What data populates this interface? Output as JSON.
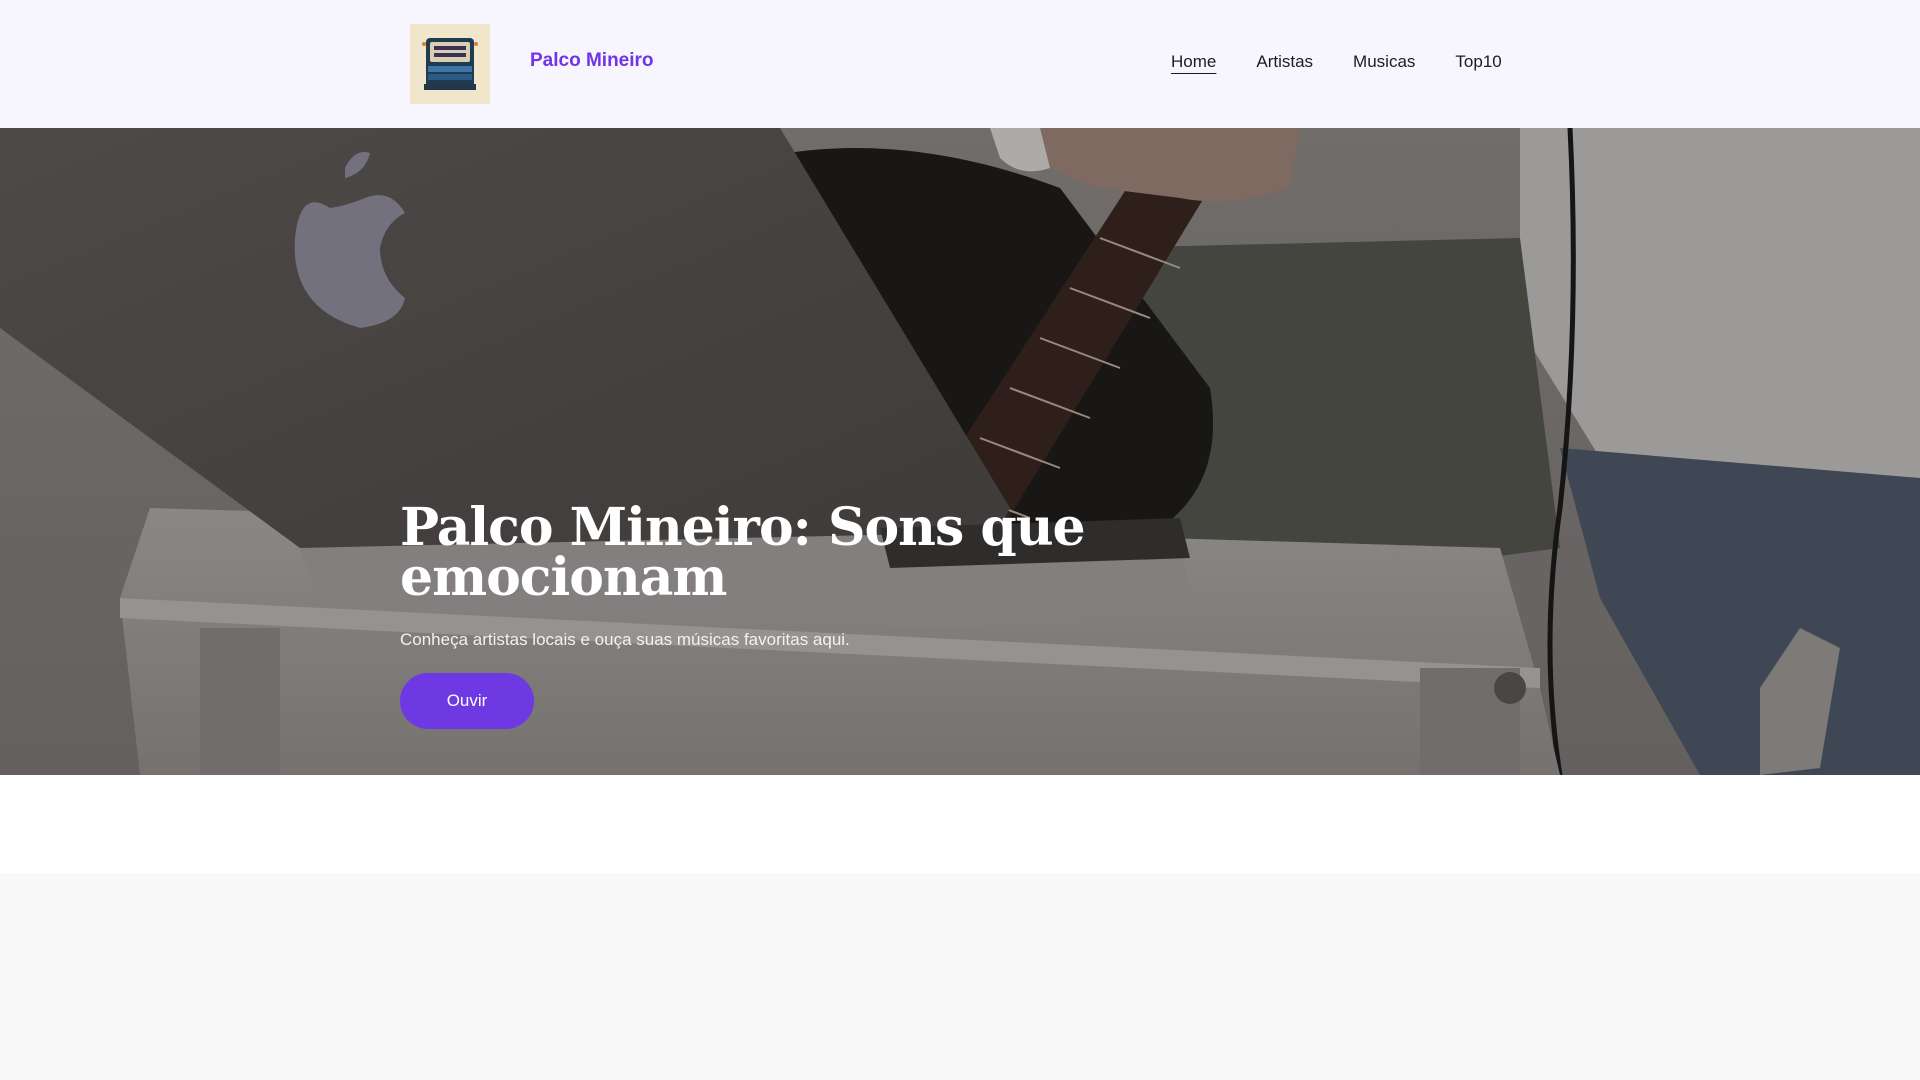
{
  "header": {
    "brand": "Palco Mineiro",
    "logo_icon": "palco-mineiro-logo",
    "nav": [
      {
        "label": "Home",
        "active": true
      },
      {
        "label": "Artistas",
        "active": false
      },
      {
        "label": "Musicas",
        "active": false
      },
      {
        "label": "Top10",
        "active": false
      }
    ]
  },
  "hero": {
    "title": "Palco Mineiro: Sons que emocionam",
    "subtitle": "Conheça artistas locais e ouça suas músicas favoritas aqui.",
    "button_label": "Ouvir"
  },
  "colors": {
    "accent": "#6e39e3",
    "brand": "#6f35e6",
    "header_bg": "#f7f5fd",
    "page_bg": "#f9f9f9"
  }
}
